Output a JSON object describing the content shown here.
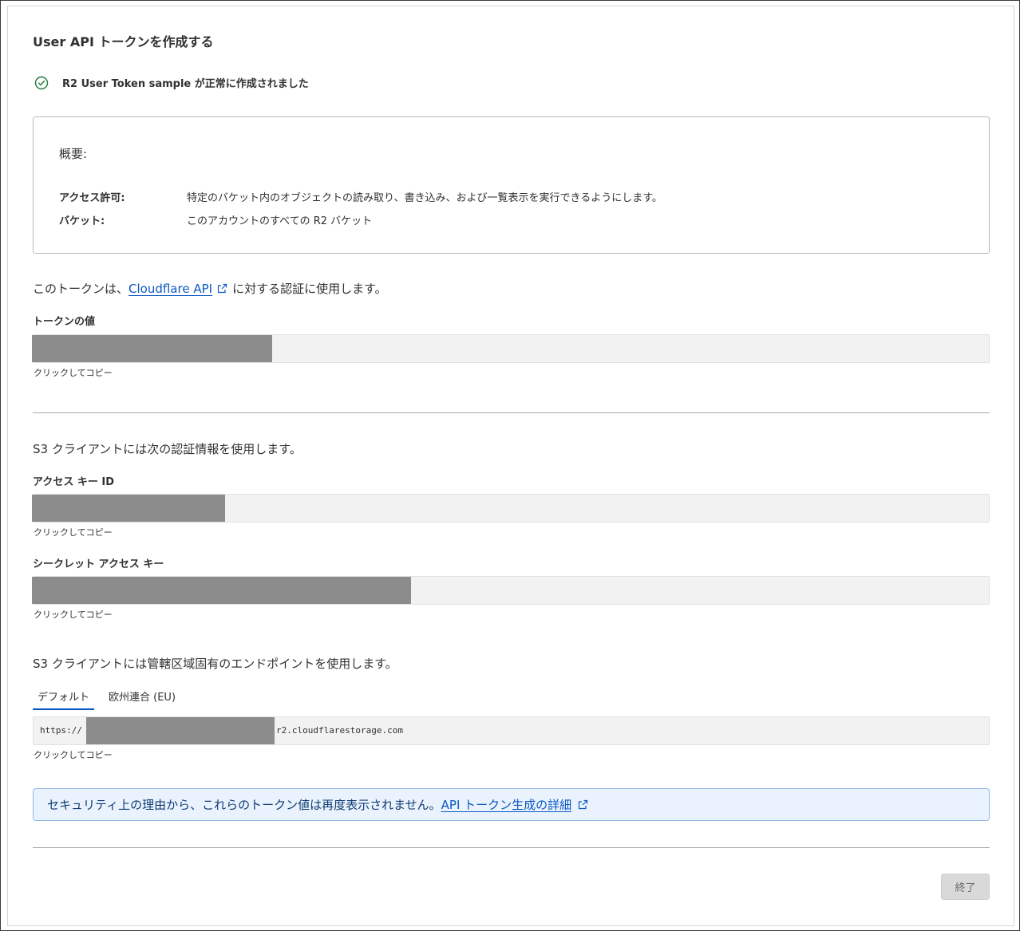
{
  "dialog": {
    "title": "User API トークンを作成する",
    "success_message": "R2 User Token sample が正常に作成されました"
  },
  "summary": {
    "heading": "概要:",
    "rows": [
      {
        "key": "アクセス許可:",
        "value": "特定のバケット内のオブジェクトの読み取り、書き込み、および一覧表示を実行できるようにします。"
      },
      {
        "key": "バケット:",
        "value": "このアカウントのすべての R2 バケット"
      }
    ]
  },
  "token_section": {
    "intro_before": "このトークンは、",
    "intro_link": "Cloudflare API",
    "intro_after": "に対する認証に使用します。",
    "label": "トークンの値",
    "hint": "クリックしてコピー"
  },
  "s3_section": {
    "intro": "S3 クライアントには次の認証情報を使用します。",
    "access_key_label": "アクセス キー ID",
    "access_key_hint": "クリックしてコピー",
    "secret_label": "シークレット アクセス キー",
    "secret_hint": "クリックしてコピー"
  },
  "endpoint_section": {
    "intro": "S3 クライアントには管轄区域固有のエンドポイントを使用します。",
    "tabs": [
      {
        "label": "デフォルト",
        "active": true
      },
      {
        "label": "欧州連合 (EU)",
        "active": false
      }
    ],
    "prefix": "https://",
    "suffix": "r2.cloudflarestorage.com",
    "hint": "クリックしてコピー"
  },
  "notice": {
    "text": "セキュリティ上の理由から、これらのトークン値は再度表示されません。",
    "link": "API トークン生成の詳細"
  },
  "footer": {
    "finish_label": "終了"
  },
  "colors": {
    "accent": "#0b57c2",
    "success": "#1e7a3a",
    "notice_bg": "#eaf3fd",
    "mask": "#8c8c8c"
  }
}
